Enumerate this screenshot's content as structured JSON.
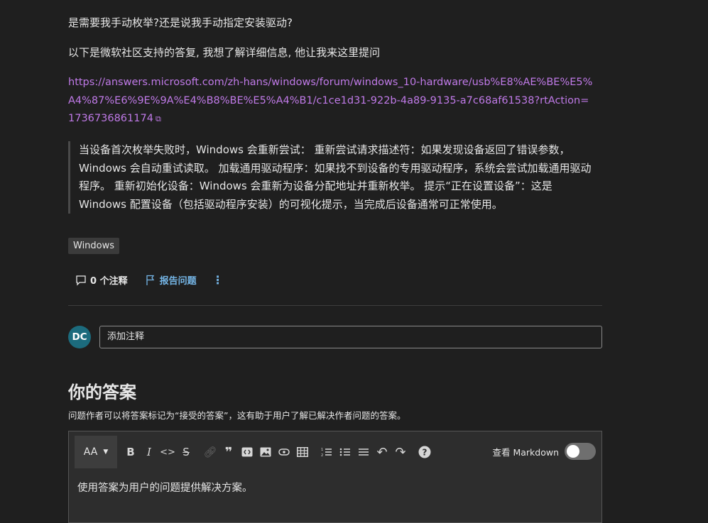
{
  "question": {
    "line1": "是需要我手动枚举?还是说我手动指定安装驱动?",
    "line2": "以下是微软社区支持的答复, 我想了解详细信息, 他让我来这里提问",
    "link_url": "https://answers.microsoft.com/zh-hans/windows/forum/windows_10-hardware/usb%E8%AE%BE%E5%A4%87%E6%9E%9A%E4%B8%BE%E5%A4%B1/c1ce1d31-922b-4a89-9135-a7c68af61538?rtAction=1736736861174",
    "quote": "当设备首次枚举失败时，Windows 会重新尝试： 重新尝试请求描述符：如果发现设备返回了错误参数，Windows 会自动重试读取。 加载通用驱动程序：如果找不到设备的专用驱动程序，系统会尝试加载通用驱动程序。 重新初始化设备：Windows 会重新为设备分配地址并重新枚举。 提示“正在设置设备”：这是 Windows 配置设备（包括驱动程序安装）的可视化提示，当完成后设备通常可正常使用。",
    "tag": "Windows"
  },
  "actions": {
    "comments": "0 个注释",
    "report": "报告问题",
    "more": "⋮"
  },
  "comment": {
    "avatar": "DC",
    "placeholder": "添加注释"
  },
  "answer": {
    "title": "你的答案",
    "subtitle": "问题作者可以将答案标记为“接受的答案”，这有助于用户了解已解决作者问题的答案。",
    "aa_label": "AA",
    "markdown_label": "查看 Markdown",
    "markdown_on": false,
    "editor_placeholder": "使用答案为用户的问题提供解决方案。"
  }
}
